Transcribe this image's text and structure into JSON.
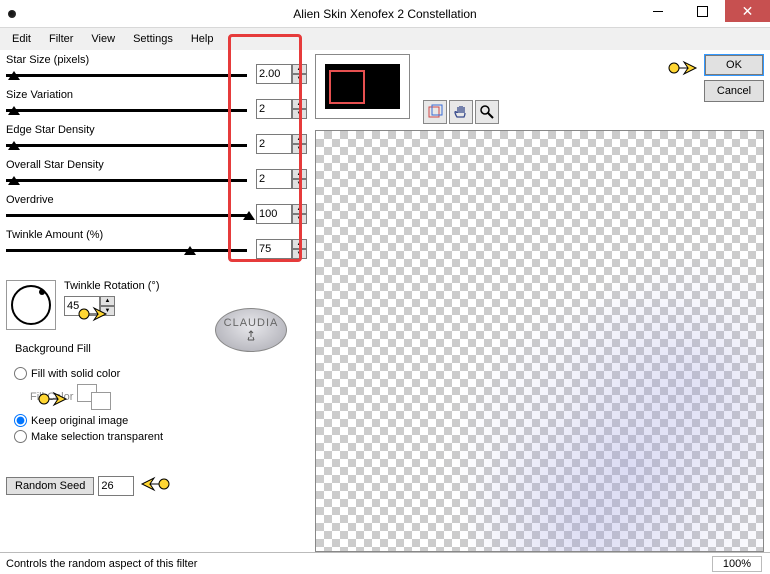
{
  "window": {
    "title": "Alien Skin Xenofex 2 Constellation"
  },
  "menu": [
    "Edit",
    "Filter",
    "View",
    "Settings",
    "Help"
  ],
  "sliders": [
    {
      "label": "Star Size (pixels)",
      "value": "2.00",
      "thumb_pct": 3
    },
    {
      "label": "Size Variation",
      "value": "2",
      "thumb_pct": 3
    },
    {
      "label": "Edge Star Density",
      "value": "2",
      "thumb_pct": 3
    },
    {
      "label": "Overall Star Density",
      "value": "2",
      "thumb_pct": 3
    },
    {
      "label": "Overdrive",
      "value": "100",
      "thumb_pct": 95
    },
    {
      "label": "Twinkle Amount (%)",
      "value": "75",
      "thumb_pct": 72
    }
  ],
  "twinkle_rotation": {
    "label": "Twinkle Rotation (°)",
    "value": "45"
  },
  "background_fill": {
    "legend": "Background Fill",
    "opt_solid": "Fill with solid color",
    "fill_color_label": "Fill Color",
    "opt_keep": "Keep original image",
    "opt_transparent": "Make selection transparent",
    "selected": "keep"
  },
  "random_seed": {
    "button": "Random Seed",
    "value": "26"
  },
  "badge": "CLAUDIA",
  "buttons": {
    "ok": "OK",
    "cancel": "Cancel"
  },
  "statusbar": {
    "text": "Controls the random aspect of this filter",
    "zoom": "100%"
  },
  "tools": [
    "preview-toggle-icon",
    "pan-icon",
    "zoom-icon"
  ]
}
